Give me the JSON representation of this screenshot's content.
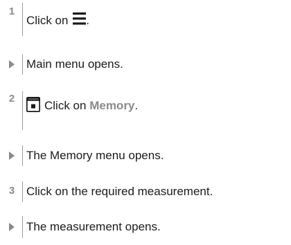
{
  "steps": [
    {
      "number": "1",
      "text_before": "Click on",
      "icon": "menu-icon",
      "text_after": "."
    },
    {
      "result": "Main menu opens."
    },
    {
      "number": "2",
      "icon": "memory-icon",
      "text_before": "Click on",
      "highlight": "Memory",
      "text_after": "."
    },
    {
      "result": "The Memory menu opens."
    },
    {
      "number": "3",
      "text": "Click on the required measurement."
    },
    {
      "result": "The measurement opens."
    }
  ],
  "colors": {
    "marker": "#8a8a8a",
    "text": "#1a1a1a",
    "highlight": "#8a8a8a"
  }
}
